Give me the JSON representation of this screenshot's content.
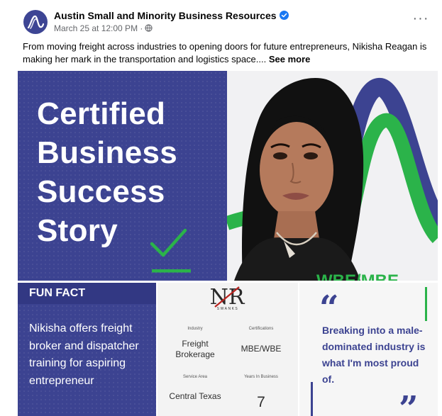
{
  "post": {
    "page_name": "Austin Small and Minority Business Resources",
    "timestamp": "March 25 at 12:00 PM",
    "dot_separator": "·",
    "caption": "From moving freight across industries to opening doors for future entrepreneurs, Nikisha Reagan is making her mark in the transportation and logistics space....",
    "see_more": "See more",
    "more_icon_text": "···"
  },
  "graphic": {
    "headline_lines": [
      "Certified",
      "Business",
      "Success",
      "Story"
    ],
    "photo_overlay_text": "WBE/MBE",
    "fun_fact": {
      "title": "FUN FACT",
      "body": "Nikisha offers freight broker and dispatcher training for aspiring entrepreneur"
    },
    "logo": {
      "letters": "NR",
      "sub": "SWANKS"
    },
    "stats": [
      {
        "label": "Industry",
        "value": "Freight Brokerage"
      },
      {
        "label": "Certifications",
        "value": "MBE/WBE"
      },
      {
        "label": "Service Area",
        "value": "Central Texas"
      },
      {
        "label": "Years In Business",
        "value": "7"
      }
    ],
    "quote": {
      "open": "“",
      "close": "”",
      "text": "Breaking into a male-dominated industry is what I'm most proud of."
    }
  },
  "colors": {
    "brand_navy": "#3c4391",
    "brand_green": "#2bb34a",
    "verified_blue": "#1877f2"
  },
  "icons": [
    "brand-logo-icon",
    "verified-badge-icon",
    "globe-icon",
    "more-options-icon",
    "checkmark-icon"
  ]
}
